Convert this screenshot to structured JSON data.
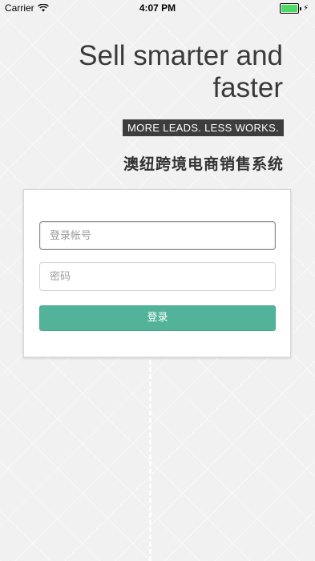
{
  "status_bar": {
    "carrier": "Carrier",
    "time": "4:07 PM",
    "wifi_icon": "wifi-icon",
    "battery_icon": "battery-charging-icon"
  },
  "hero": {
    "title": "Sell smarter and faster",
    "tagline": "MORE LEADS. LESS WORKS.",
    "system_name": "澳纽跨境电商销售系统"
  },
  "login": {
    "username_placeholder": "登录帐号",
    "password_placeholder": "密码",
    "submit_label": "登录"
  },
  "colors": {
    "accent": "#52b39a",
    "tagline_bg": "#3d3d3d",
    "background": "#f1f1f1"
  }
}
